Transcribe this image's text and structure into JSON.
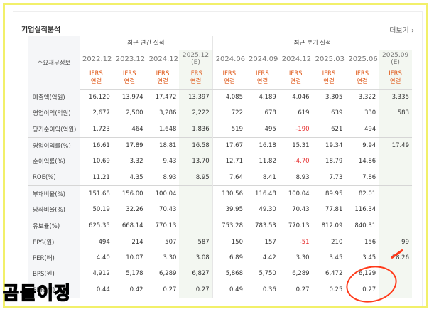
{
  "header": {
    "title": "기업실적분석",
    "more_label": "더보기",
    "more_icon": "chevron-right-icon"
  },
  "table": {
    "corner_label": "주요재무정보",
    "groups": {
      "annual": "최근 연간 실적",
      "quarterly": "최근 분기 실적"
    },
    "periods": [
      {
        "label": "2022.12"
      },
      {
        "label": "2023.12"
      },
      {
        "label": "2024.12"
      },
      {
        "label": "2025.12",
        "estimate": "(E)"
      },
      {
        "label": "2024.06"
      },
      {
        "label": "2024.09"
      },
      {
        "label": "2024.12"
      },
      {
        "label": "2025.03"
      },
      {
        "label": "2025.06"
      },
      {
        "label": "2025.09",
        "estimate": "(E)"
      }
    ],
    "ifrs_top": "IFRS",
    "ifrs_bottom": "연결",
    "rows": [
      {
        "label": "매출액(억원)",
        "values": [
          "16,120",
          "13,974",
          "17,472",
          "13,397",
          "4,085",
          "4,189",
          "4,046",
          "3,305",
          "3,322",
          "3,335"
        ]
      },
      {
        "label": "영업이익(억원)",
        "values": [
          "2,677",
          "2,500",
          "3,286",
          "2,222",
          "722",
          "678",
          "619",
          "639",
          "330",
          "583"
        ]
      },
      {
        "label": "당기순이익(억원)",
        "values": [
          "1,723",
          "464",
          "1,648",
          "1,836",
          "519",
          "495",
          "-190",
          "621",
          "494",
          ""
        ]
      },
      {
        "label": "영업이익률(%)",
        "values": [
          "16.61",
          "17.89",
          "18.81",
          "16.58",
          "17.67",
          "16.18",
          "15.31",
          "19.34",
          "9.94",
          "17.49"
        ]
      },
      {
        "label": "순이익률(%)",
        "values": [
          "10.69",
          "3.32",
          "9.43",
          "13.70",
          "12.71",
          "11.82",
          "-4.70",
          "18.79",
          "14.86",
          ""
        ]
      },
      {
        "label": "ROE(%)",
        "values": [
          "11.21",
          "4.35",
          "8.93",
          "8.95",
          "7.64",
          "8.41",
          "8.93",
          "7.73",
          "7.86",
          ""
        ]
      },
      {
        "label": "부채비율(%)",
        "values": [
          "151.68",
          "156.00",
          "100.04",
          "",
          "130.56",
          "116.48",
          "100.04",
          "89.95",
          "82.01",
          ""
        ]
      },
      {
        "label": "당좌비율(%)",
        "values": [
          "50.19",
          "32.26",
          "70.43",
          "",
          "39.95",
          "49.30",
          "70.43",
          "77.81",
          "116.34",
          ""
        ]
      },
      {
        "label": "유보율(%)",
        "values": [
          "625.35",
          "668.14",
          "770.13",
          "",
          "753.28",
          "783.53",
          "770.13",
          "812.09",
          "840.31",
          ""
        ]
      },
      {
        "label": "EPS(원)",
        "values": [
          "494",
          "214",
          "507",
          "587",
          "150",
          "157",
          "-51",
          "210",
          "156",
          "99"
        ]
      },
      {
        "label": "PER(배)",
        "values": [
          "4.40",
          "10.07",
          "3.30",
          "3.08",
          "6.89",
          "4.42",
          "3.30",
          "3.45",
          "3.45",
          "18.26"
        ]
      },
      {
        "label": "BPS(원)",
        "values": [
          "4,912",
          "5,178",
          "6,289",
          "6,827",
          "5,868",
          "5,750",
          "6,289",
          "6,472",
          "6,129",
          ""
        ]
      },
      {
        "label": "PBR(배)",
        "values": [
          "0.44",
          "0.42",
          "0.27",
          "0.27",
          "0.49",
          "0.36",
          "0.27",
          "0.25",
          "0.27",
          ""
        ]
      }
    ]
  },
  "watermark": "곰돌이정",
  "colors": {
    "ifrs": "#e05a1a",
    "negative": "#e52b2b",
    "annotation": "#ff3a1a",
    "frame": "#f2f06a"
  }
}
